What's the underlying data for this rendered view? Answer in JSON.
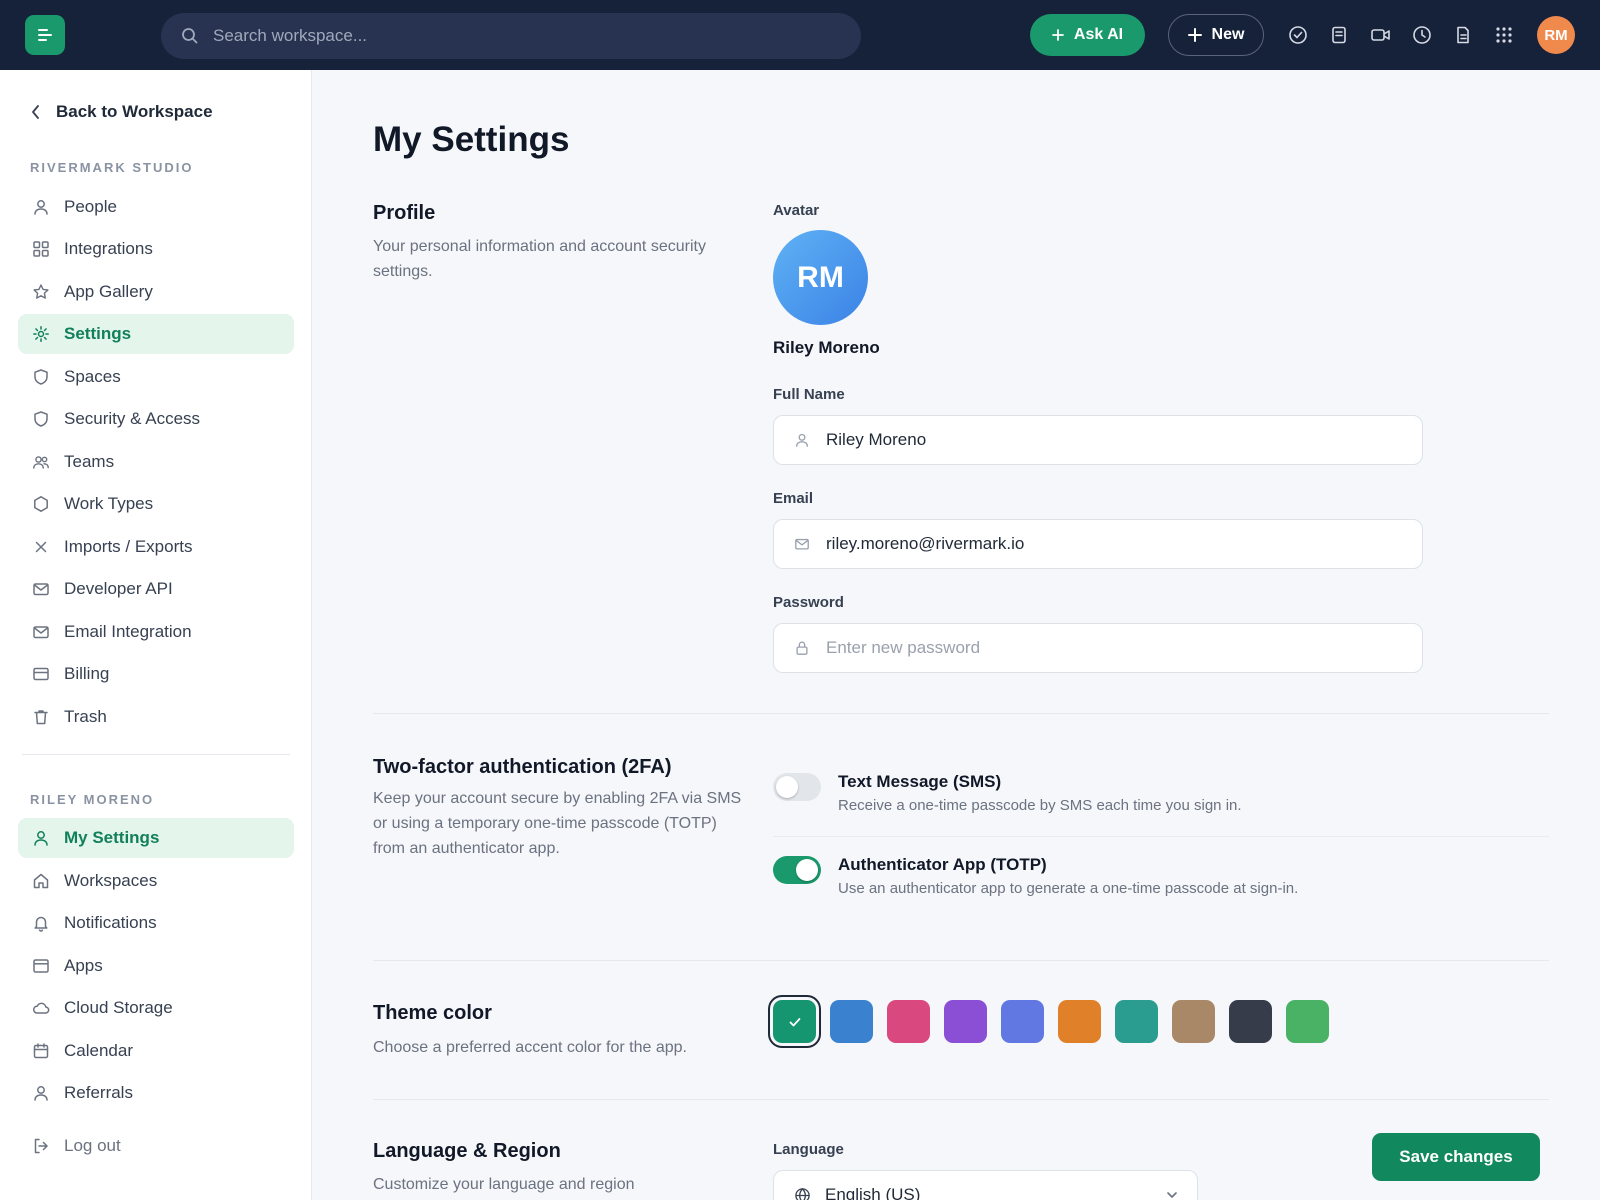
{
  "topbar": {
    "search_placeholder": "Search workspace...",
    "ask_ai_label": "Ask AI",
    "new_label": "New",
    "user_initials": "RM"
  },
  "sidebar": {
    "back_label": "Back to Workspace",
    "org_section": "RIVERMARK STUDIO",
    "org_items": [
      {
        "label": "People",
        "icon": "person-icon"
      },
      {
        "label": "Integrations",
        "icon": "grid-icon"
      },
      {
        "label": "App Gallery",
        "icon": "star-icon"
      },
      {
        "label": "Settings",
        "icon": "gear-icon",
        "active": true
      },
      {
        "label": "Spaces",
        "icon": "shield-icon"
      },
      {
        "label": "Security & Access",
        "icon": "shield-icon"
      },
      {
        "label": "Teams",
        "icon": "people-icon"
      },
      {
        "label": "Work Types",
        "icon": "hexagon-icon"
      },
      {
        "label": "Imports / Exports",
        "icon": "x-icon"
      },
      {
        "label": "Developer API",
        "icon": "mail-icon"
      },
      {
        "label": "Email Integration",
        "icon": "mail-icon"
      },
      {
        "label": "Billing",
        "icon": "card-icon"
      },
      {
        "label": "Trash",
        "icon": "trash-icon"
      }
    ],
    "user_section": "RILEY MORENO",
    "user_items": [
      {
        "label": "My Settings",
        "icon": "person-icon",
        "active": true
      },
      {
        "label": "Workspaces",
        "icon": "home-icon"
      },
      {
        "label": "Notifications",
        "icon": "bell-icon"
      },
      {
        "label": "Apps",
        "icon": "window-icon"
      },
      {
        "label": "Cloud Storage",
        "icon": "cloud-icon"
      },
      {
        "label": "Calendar",
        "icon": "calendar-icon"
      },
      {
        "label": "Referrals",
        "icon": "person-icon"
      }
    ],
    "logout_label": "Log out"
  },
  "main": {
    "title": "My Settings",
    "profile": {
      "heading": "Profile",
      "description": "Your personal information and account security settings.",
      "avatar_label": "Avatar",
      "avatar_initials": "RM",
      "display_name": "Riley Moreno",
      "full_name_label": "Full Name",
      "full_name_value": "Riley Moreno",
      "email_label": "Email",
      "email_value": "riley.moreno@rivermark.io",
      "password_label": "Password",
      "password_placeholder": "Enter new password"
    },
    "twofa": {
      "heading": "Two-factor authentication (2FA)",
      "description": "Keep your account secure by enabling 2FA via SMS or using a temporary one-time passcode (TOTP) from an authenticator app.",
      "options": [
        {
          "title": "Text Message (SMS)",
          "desc": "Receive a one-time passcode by SMS each time you sign in.",
          "enabled": false
        },
        {
          "title": "Authenticator App (TOTP)",
          "desc": "Use an authenticator app to generate a one-time passcode at sign-in.",
          "enabled": true
        }
      ]
    },
    "theme": {
      "heading": "Theme color",
      "description": "Choose a preferred accent color for the app.",
      "colors": [
        "#159570",
        "#3a82cf",
        "#d9487e",
        "#8b4fd6",
        "#6178e2",
        "#e08028",
        "#2a9d90",
        "#a98868",
        "#373c4a",
        "#4ab265"
      ],
      "selected_index": 0
    },
    "language": {
      "heading": "Language & Region",
      "description": "Customize your language and region",
      "language_label": "Language",
      "language_value": "English (US)"
    },
    "save_label": "Save changes"
  }
}
